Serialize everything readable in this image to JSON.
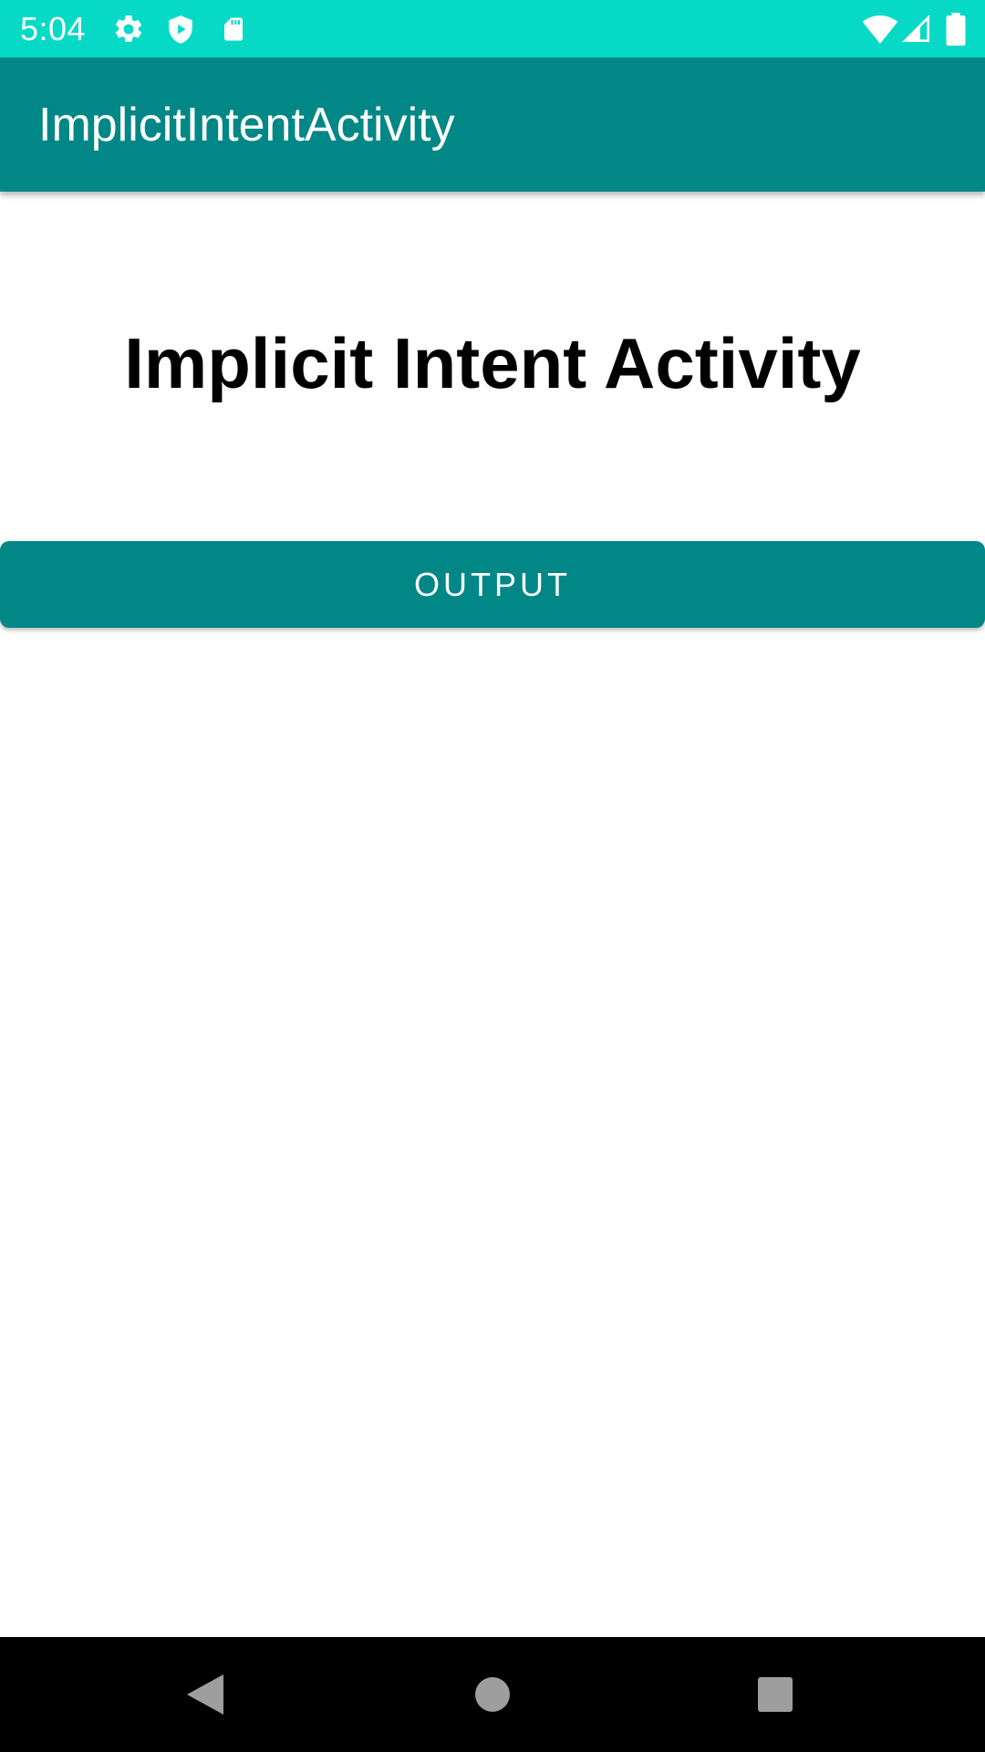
{
  "status_bar": {
    "time": "5:04",
    "icons_left": [
      "settings-icon",
      "play-protect-icon",
      "sd-card-icon"
    ],
    "icons_right": [
      "wifi-icon",
      "cell-signal-icon",
      "battery-icon"
    ],
    "background": "#06DAC6"
  },
  "app_bar": {
    "title": "ImplicitIntentActivity",
    "background": "#018786"
  },
  "main": {
    "heading": "Implicit Intent Activity",
    "output_button_label": "OUTPUT",
    "button_color": "#018786"
  },
  "nav_bar": {
    "buttons": [
      "back-icon",
      "home-icon",
      "recents-icon"
    ]
  }
}
